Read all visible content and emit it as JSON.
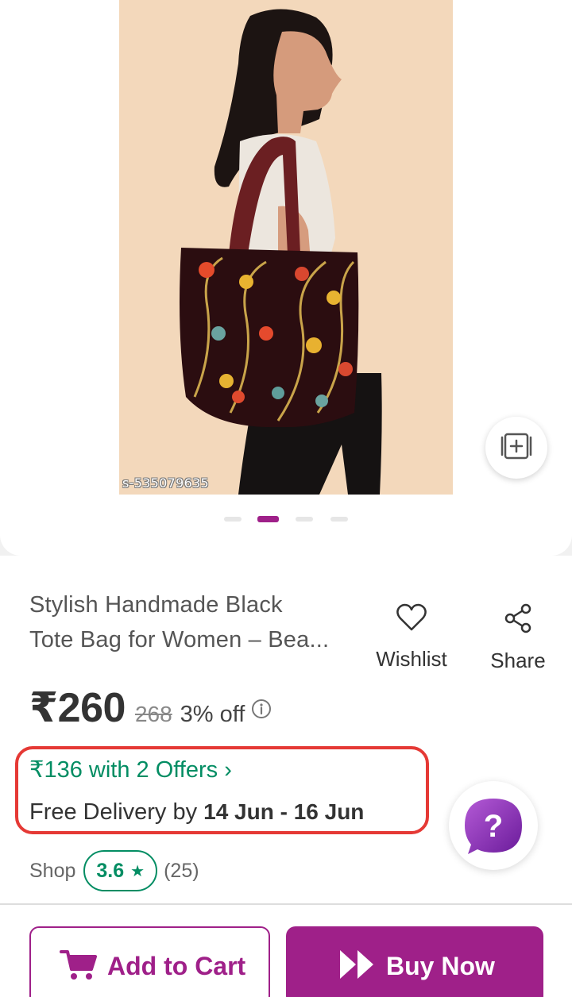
{
  "gallery": {
    "sku_watermark": "s-535079635",
    "slide_count": 4,
    "active_slide": 2
  },
  "product": {
    "title_line1": "Stylish Handmade Black",
    "title_line2": "Tote Bag for Women – Bea...",
    "price": "₹260",
    "mrp": "268",
    "discount": "3% off",
    "offers_text": "₹136 with 2 Offers ›",
    "delivery_prefix": "Free Delivery by",
    "delivery_date": "14 Jun - 16 Jun"
  },
  "actions": {
    "wishlist_label": "Wishlist",
    "share_label": "Share"
  },
  "shop": {
    "label": "Shop",
    "rating": "3.6",
    "rating_count": "(25)"
  },
  "bottom_bar": {
    "add_to_cart_label": "Add to Cart",
    "buy_now_label": "Buy Now"
  },
  "colors": {
    "brand_purple": "#9f2089",
    "offer_green": "#038d63",
    "highlight_red": "#e53935"
  },
  "icons": [
    "compare-icon",
    "heart-icon",
    "share-icon",
    "info-icon",
    "help-icon",
    "cart-icon",
    "fast-forward-icon",
    "star-icon"
  ]
}
